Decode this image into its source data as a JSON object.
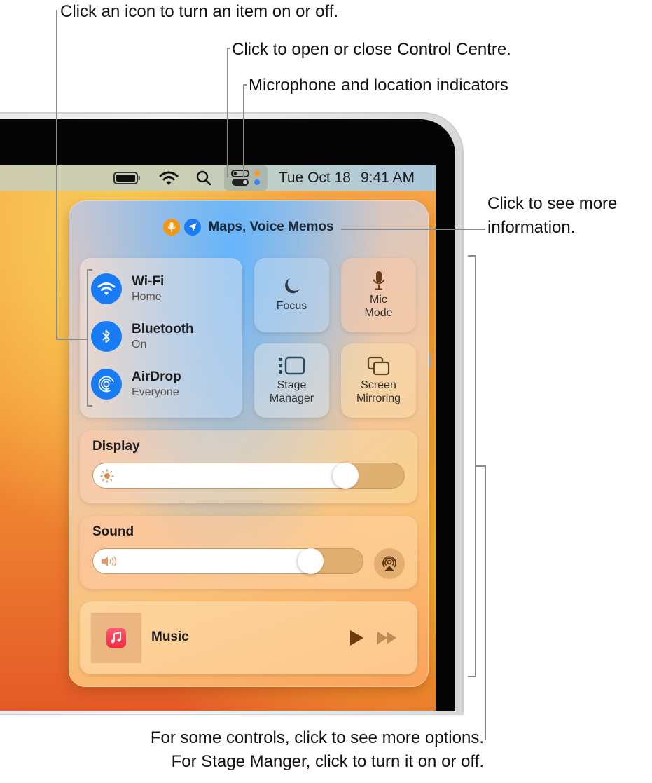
{
  "callouts": {
    "icon_toggle": "Click an icon to turn an item on or off.",
    "control_centre": "Click to open or close Control Centre.",
    "indicators": "Microphone and location indicators",
    "more_info_line1": "Click to see more",
    "more_info_line2": "information.",
    "options_line1": "For some controls, click to see more options.",
    "options_line2": "For Stage Manger, click to turn it on or off."
  },
  "menubar": {
    "icons": [
      "battery-icon",
      "wifi-icon",
      "spotlight-search-icon",
      "control-centre-icon",
      "privacy-indicator-dots"
    ],
    "date": "Tue Oct 18",
    "time": "9:41 AM",
    "colors": {
      "mic_indicator": "#f59a2b",
      "location_indicator": "#3b82f6"
    }
  },
  "control_centre": {
    "header": {
      "title": "Maps, Voice Memos",
      "icons": [
        "microphone-icon",
        "location-arrow-icon"
      ],
      "colors": {
        "mic": "#f5960f",
        "location": "#1a7cf5"
      }
    },
    "connectivity": [
      {
        "label": "Wi-Fi",
        "status": "Home",
        "icon": "wifi-icon"
      },
      {
        "label": "Bluetooth",
        "status": "On",
        "icon": "bluetooth-icon"
      },
      {
        "label": "AirDrop",
        "status": "Everyone",
        "icon": "airdrop-icon"
      }
    ],
    "tiles": [
      {
        "label": "Focus",
        "icon": "moon-icon"
      },
      {
        "label": "Mic\nMode",
        "line1": "Mic",
        "line2": "Mode",
        "icon": "microphone-icon"
      },
      {
        "label": "Stage Manager",
        "line1": "Stage",
        "line2": "Manager",
        "icon": "stage-manager-icon"
      },
      {
        "label": "Screen Mirroring",
        "line1": "Screen",
        "line2": "Mirroring",
        "icon": "screen-mirroring-icon"
      }
    ],
    "display": {
      "title": "Display",
      "brightness_percent": 84
    },
    "sound": {
      "title": "Sound",
      "volume_percent": 84
    },
    "music": {
      "title": "Music",
      "app_color": "#f3273f"
    },
    "accent_color": "#1a7cf5"
  }
}
